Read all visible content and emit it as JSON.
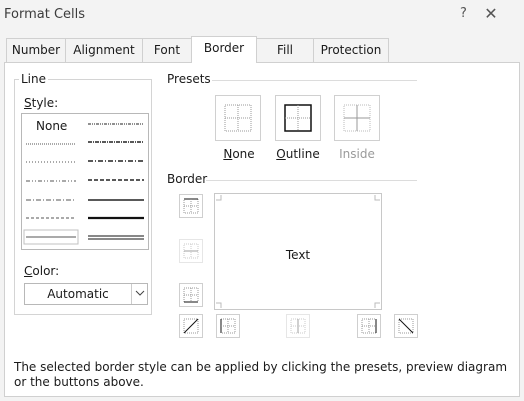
{
  "window": {
    "title": "Format Cells",
    "help": "?",
    "close": "✕"
  },
  "tabs": [
    {
      "label": "Number"
    },
    {
      "label": "Alignment"
    },
    {
      "label": "Font"
    },
    {
      "label": "Border",
      "active": true
    },
    {
      "label": "Fill"
    },
    {
      "label": "Protection"
    }
  ],
  "line": {
    "group_label": "Line",
    "style_label": "Style:",
    "none_label": "None",
    "color_label": "Color:",
    "color_value": "Automatic"
  },
  "presets": {
    "group_label": "Presets",
    "none": "None",
    "outline": "Outline",
    "inside": "Inside"
  },
  "border": {
    "group_label": "Border",
    "preview_text": "Text"
  },
  "description": "The selected border style can be applied by clicking the presets, preview diagram or the buttons above.",
  "colors": {
    "accent": "#0f6cbd",
    "disabled": "#9a9a9a"
  }
}
